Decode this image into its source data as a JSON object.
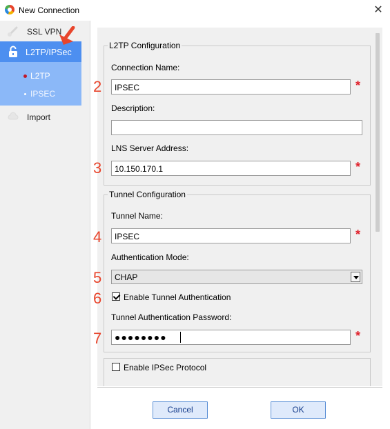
{
  "window": {
    "title": "New Connection",
    "close_glyph": "✕"
  },
  "sidebar": {
    "items": [
      {
        "label": "SSL VPN",
        "icon": "link-icon"
      },
      {
        "label": "L2TP/IPSec",
        "icon": "unlock-icon",
        "active": true
      },
      {
        "label": "Import",
        "icon": "cloud-icon"
      }
    ],
    "subitems": [
      {
        "label": "L2TP",
        "active": true
      },
      {
        "label": "IPSEC"
      }
    ]
  },
  "l2tp_config": {
    "legend": "L2TP Configuration",
    "connection_name_label": "Connection Name:",
    "connection_name_value": "IPSEC",
    "description_label": "Description:",
    "description_value": "",
    "lns_label": "LNS Server Address:",
    "lns_value": "10.150.170.1"
  },
  "tunnel_config": {
    "legend": "Tunnel Configuration",
    "tunnel_name_label": "Tunnel Name:",
    "tunnel_name_value": "IPSEC",
    "auth_mode_label": "Authentication Mode:",
    "auth_mode_value": "CHAP",
    "enable_auth_label": "Enable Tunnel Authentication",
    "enable_auth_checked": true,
    "password_label": "Tunnel Authentication Password:",
    "password_mask": "●●●●●●●●"
  },
  "ipsec": {
    "enable_label": "Enable IPSec Protocol",
    "checked": false
  },
  "required_marker": "*",
  "step_numbers": [
    "2",
    "3",
    "4",
    "5",
    "6",
    "7"
  ],
  "buttons": {
    "cancel": "Cancel",
    "ok": "OK"
  },
  "colors": {
    "accent": "#4d8ff0",
    "sub_accent": "#8bb8f8",
    "required": "#e0202a",
    "annotation": "#e8452c"
  }
}
